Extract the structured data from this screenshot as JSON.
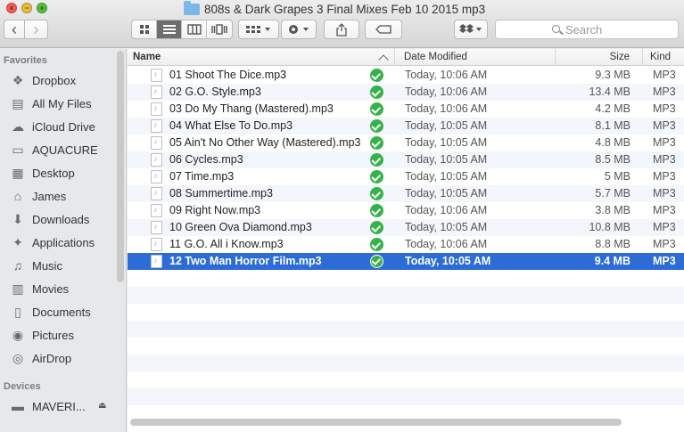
{
  "window": {
    "title": "808s & Dark Grapes 3 Final Mixes Feb 10 2015 mp3",
    "close_glyph": "×",
    "min_glyph": "−",
    "max_glyph": "+"
  },
  "toolbar": {
    "back_glyph": "‹",
    "forward_glyph": "›",
    "search_placeholder": "Search"
  },
  "sidebar": {
    "favorites_heading": "Favorites",
    "favorites": [
      {
        "label": "Dropbox",
        "icon": "dropbox-icon",
        "glyph": "❖"
      },
      {
        "label": "All My Files",
        "icon": "all-files-icon",
        "glyph": "▤"
      },
      {
        "label": "iCloud Drive",
        "icon": "cloud-icon",
        "glyph": "☁"
      },
      {
        "label": "AQUACURE",
        "icon": "folder-icon",
        "glyph": "▭"
      },
      {
        "label": "Desktop",
        "icon": "desktop-icon",
        "glyph": "▦"
      },
      {
        "label": "James",
        "icon": "home-icon",
        "glyph": "⌂"
      },
      {
        "label": "Downloads",
        "icon": "download-icon",
        "glyph": "⬇"
      },
      {
        "label": "Applications",
        "icon": "applications-icon",
        "glyph": "✦"
      },
      {
        "label": "Music",
        "icon": "music-icon",
        "glyph": "♫"
      },
      {
        "label": "Movies",
        "icon": "movies-icon",
        "glyph": "▥"
      },
      {
        "label": "Documents",
        "icon": "documents-icon",
        "glyph": "▯"
      },
      {
        "label": "Pictures",
        "icon": "camera-icon",
        "glyph": "◉"
      },
      {
        "label": "AirDrop",
        "icon": "airdrop-icon",
        "glyph": "◎"
      }
    ],
    "devices_heading": "Devices",
    "devices": [
      {
        "label": "MAVERI...",
        "icon": "disk-icon",
        "glyph": "▬",
        "eject": "⏏"
      }
    ]
  },
  "columns": {
    "name": "Name",
    "date": "Date Modified",
    "size": "Size",
    "kind": "Kind"
  },
  "files": [
    {
      "name": "01 Shoot The Dice.mp3",
      "date": "Today, 10:06 AM",
      "size": "9.3 MB",
      "kind": "MP3"
    },
    {
      "name": "02 G.O. Style.mp3",
      "date": "Today, 10:06 AM",
      "size": "13.4 MB",
      "kind": "MP3"
    },
    {
      "name": "03 Do My Thang (Mastered).mp3",
      "date": "Today, 10:06 AM",
      "size": "4.2 MB",
      "kind": "MP3"
    },
    {
      "name": "04 What Else To Do.mp3",
      "date": "Today, 10:05 AM",
      "size": "8.1 MB",
      "kind": "MP3"
    },
    {
      "name": "05 Ain't No Other Way (Mastered).mp3",
      "date": "Today, 10:05 AM",
      "size": "4.8 MB",
      "kind": "MP3"
    },
    {
      "name": "06 Cycles.mp3",
      "date": "Today, 10:05 AM",
      "size": "8.5 MB",
      "kind": "MP3"
    },
    {
      "name": "07 Time.mp3",
      "date": "Today, 10:05 AM",
      "size": "5 MB",
      "kind": "MP3"
    },
    {
      "name": "08 Summertime.mp3",
      "date": "Today, 10:05 AM",
      "size": "5.7 MB",
      "kind": "MP3"
    },
    {
      "name": "09 Right Now.mp3",
      "date": "Today, 10:06 AM",
      "size": "3.8 MB",
      "kind": "MP3"
    },
    {
      "name": "10 Green Ova Diamond.mp3",
      "date": "Today, 10:05 AM",
      "size": "10.8 MB",
      "kind": "MP3"
    },
    {
      "name": "11 G.O. All i Know.mp3",
      "date": "Today, 10:06 AM",
      "size": "8.8 MB",
      "kind": "MP3"
    },
    {
      "name": "12 Two Man Horror Film.mp3",
      "date": "Today, 10:05 AM",
      "size": "9.4 MB",
      "kind": "MP3",
      "selected": true
    }
  ],
  "colors": {
    "selection": "#2d6cd6",
    "sync_ok": "#35b34a"
  }
}
